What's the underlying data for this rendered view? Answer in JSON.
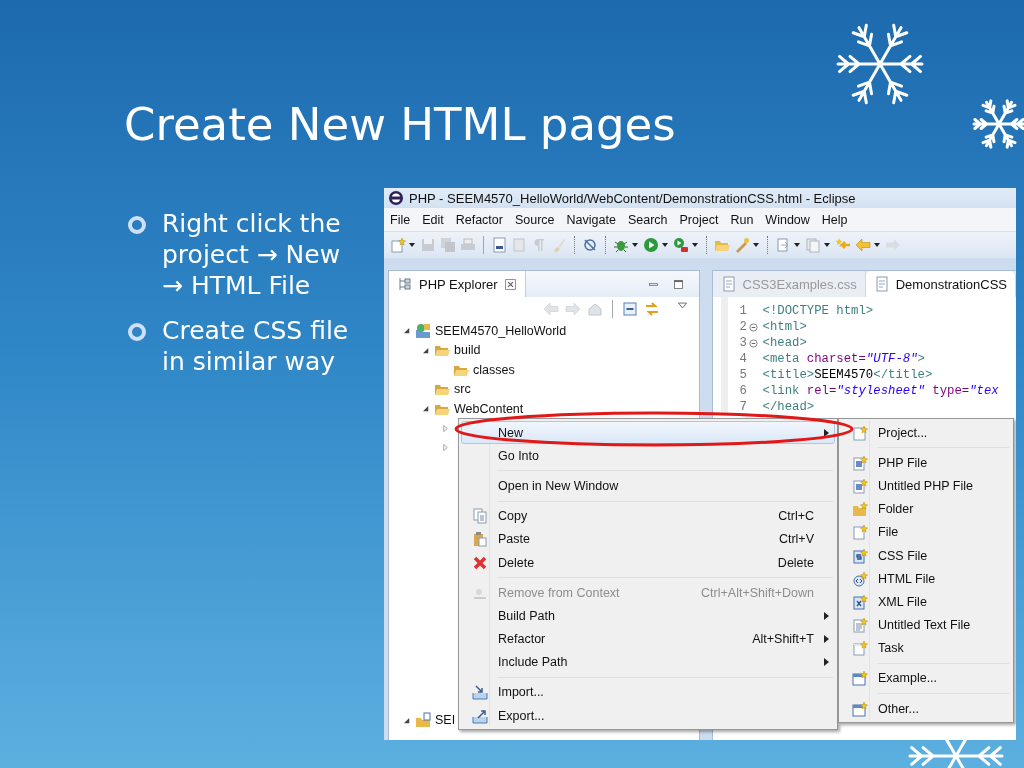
{
  "slide": {
    "title": "Create New HTML pages",
    "bullets": [
      "Right click the project  → New → HTML File",
      "Create CSS file in similar way"
    ]
  },
  "window": {
    "title": "PHP - SEEM4570_HelloWorld/WebContent/DemonstrationCSS.html - Eclipse"
  },
  "menu_bar": [
    {
      "label": "File"
    },
    {
      "label": "Edit"
    },
    {
      "label": "Refactor"
    },
    {
      "label": "Source"
    },
    {
      "label": "Navigate"
    },
    {
      "label": "Search"
    },
    {
      "label": "Project"
    },
    {
      "label": "Run"
    },
    {
      "label": "Window"
    },
    {
      "label": "Help"
    }
  ],
  "explorer": {
    "tab": "PHP Explorer",
    "tree": [
      {
        "label": "SEEM4570_HelloWorld",
        "expanded": true,
        "children": [
          {
            "label": "build",
            "expanded": true,
            "children": [
              {
                "label": "classes"
              }
            ]
          },
          {
            "label": "src"
          },
          {
            "label": "WebContent",
            "expanded": true,
            "children": [
              {
                "expanded": false
              },
              {
                "expanded": false
              }
            ]
          }
        ]
      },
      {
        "label": "SEI",
        "expanded": true
      }
    ]
  },
  "editor": {
    "tabs": [
      {
        "label": "CSS3Examples.css",
        "selected": false
      },
      {
        "label": "DemonstrationCSS",
        "selected": true
      }
    ],
    "lines": [
      {
        "number": "1",
        "fold": false,
        "segments": [
          {
            "kind": "tag",
            "text": "<!DOCTYPE html>"
          }
        ]
      },
      {
        "number": "2",
        "fold": true,
        "segments": [
          {
            "kind": "tag",
            "text": "<html>"
          }
        ]
      },
      {
        "number": "3",
        "fold": true,
        "segments": [
          {
            "kind": "tag",
            "text": "<head>"
          }
        ]
      },
      {
        "number": "4",
        "fold": false,
        "segments": [
          {
            "kind": "tag",
            "text": "<meta"
          },
          {
            "kind": "attr",
            "text": " charset="
          },
          {
            "kind": "value",
            "text": "\"UTF-8\""
          },
          {
            "kind": "tag",
            "text": ">"
          }
        ]
      },
      {
        "number": "5",
        "fold": false,
        "segments": [
          {
            "kind": "tag",
            "text": "<title>"
          },
          {
            "kind": "text",
            "text": "SEEM4570"
          },
          {
            "kind": "tag",
            "text": "</title>"
          }
        ]
      },
      {
        "number": "6",
        "fold": false,
        "segments": [
          {
            "kind": "tag",
            "text": "<link"
          },
          {
            "kind": "attr",
            "text": " rel="
          },
          {
            "kind": "value",
            "text": "\"stylesheet\""
          },
          {
            "kind": "attr",
            "text": " type="
          },
          {
            "kind": "value",
            "text": "\"tex"
          }
        ]
      },
      {
        "number": "7",
        "fold": false,
        "segments": [
          {
            "kind": "tag",
            "text": "</head>"
          }
        ]
      }
    ]
  },
  "context_menu": {
    "items": [
      {
        "kind": "item",
        "label": "New",
        "submenu": true,
        "disabled": false,
        "selected": true
      },
      {
        "kind": "item",
        "label": "Go Into",
        "submenu": false,
        "disabled": false,
        "selected": false
      },
      {
        "kind": "separator"
      },
      {
        "kind": "item",
        "label": "Open in New Window",
        "submenu": false,
        "disabled": false,
        "selected": false
      },
      {
        "kind": "separator"
      },
      {
        "kind": "item",
        "label": "Copy",
        "shortcut": "Ctrl+C",
        "submenu": false,
        "disabled": false,
        "selected": false
      },
      {
        "kind": "item",
        "label": "Paste",
        "shortcut": "Ctrl+V",
        "submenu": false,
        "disabled": false,
        "selected": false
      },
      {
        "kind": "item",
        "label": "Delete",
        "shortcut": "Delete",
        "submenu": false,
        "disabled": false,
        "selected": false
      },
      {
        "kind": "separator"
      },
      {
        "kind": "item",
        "label": "Remove from Context",
        "shortcut": "Ctrl+Alt+Shift+Down",
        "submenu": false,
        "disabled": true,
        "selected": false
      },
      {
        "kind": "item",
        "label": "Build Path",
        "submenu": true,
        "disabled": false,
        "selected": false
      },
      {
        "kind": "item",
        "label": "Refactor",
        "shortcut": "Alt+Shift+T",
        "submenu": true,
        "disabled": false,
        "selected": false
      },
      {
        "kind": "item",
        "label": "Include Path",
        "submenu": true,
        "disabled": false,
        "selected": false
      },
      {
        "kind": "separator"
      },
      {
        "kind": "item",
        "label": "Import...",
        "submenu": false,
        "disabled": false,
        "selected": false
      },
      {
        "kind": "item",
        "label": "Export...",
        "submenu": false,
        "disabled": false,
        "selected": false
      }
    ]
  },
  "submenu": {
    "items": [
      {
        "kind": "item",
        "label": "Project...",
        "selected": false
      },
      {
        "kind": "separator"
      },
      {
        "kind": "item",
        "label": "PHP File",
        "selected": false
      },
      {
        "kind": "item",
        "label": "Untitled PHP File",
        "selected": false
      },
      {
        "kind": "item",
        "label": "Folder",
        "selected": false
      },
      {
        "kind": "item",
        "label": "File",
        "selected": false
      },
      {
        "kind": "item",
        "label": "CSS File",
        "selected": false
      },
      {
        "kind": "item",
        "label": "HTML File",
        "selected": false
      },
      {
        "kind": "item",
        "label": "XML File",
        "selected": false
      },
      {
        "kind": "item",
        "label": "Untitled Text File",
        "selected": false
      },
      {
        "kind": "item",
        "label": "Task",
        "selected": false
      },
      {
        "kind": "separator"
      },
      {
        "kind": "item",
        "label": "Example...",
        "selected": false
      },
      {
        "kind": "separator"
      },
      {
        "kind": "item",
        "label": "Other...",
        "selected": false
      }
    ]
  }
}
